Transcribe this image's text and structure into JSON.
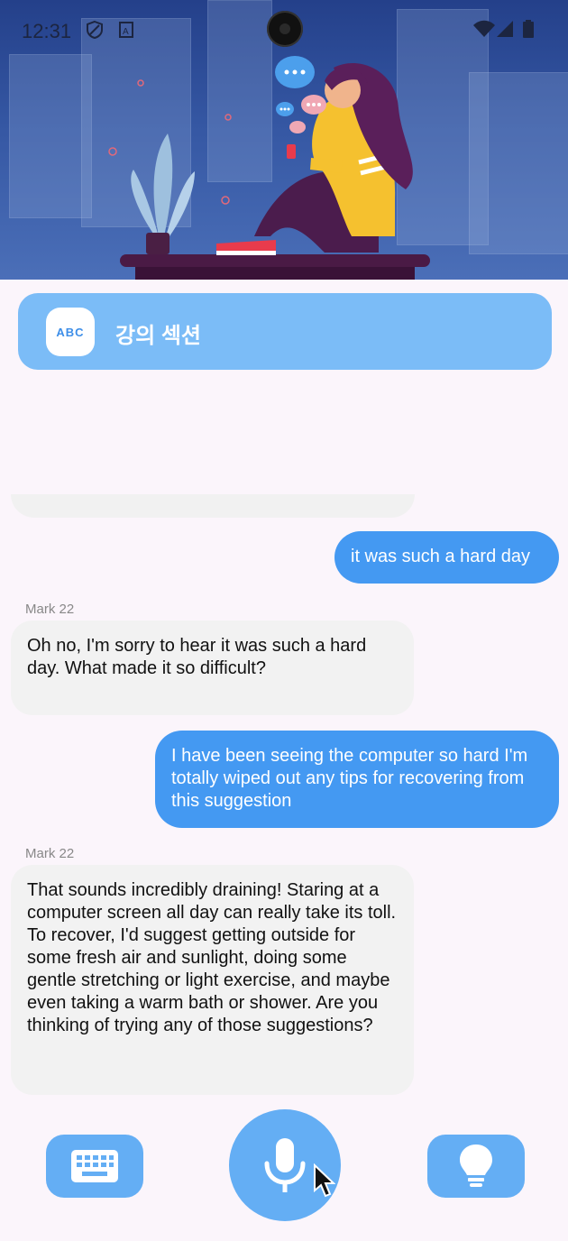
{
  "status_bar": {
    "time": "12:31"
  },
  "lecture": {
    "badge": "ABC",
    "title": "강의 섹션"
  },
  "chat": {
    "messages": [
      {
        "role": "user",
        "text": "it was such a hard day"
      },
      {
        "role": "bot",
        "sender": "Mark 22",
        "text": "Oh no, I'm sorry to hear it was such a hard day.  What made it so difficult?"
      },
      {
        "role": "user",
        "text": "I have been seeing the computer so hard I'm totally wiped out any tips for recovering from this suggestion"
      },
      {
        "role": "bot",
        "sender": "Mark 22",
        "text": "That sounds incredibly draining!  Staring at a computer screen all day can really take its toll.  To recover, I'd suggest getting outside for some fresh air and sunlight, doing some gentle stretching or light exercise, and maybe even taking a warm bath or shower.  Are you thinking of trying any of those suggestions?"
      }
    ]
  },
  "controls": {
    "left_icon": "keyboard-icon",
    "center_icon": "microphone-icon",
    "right_icon": "lightbulb-icon"
  },
  "colors": {
    "accent": "#4499f2",
    "card": "#7bbcf7",
    "button": "#64aef4",
    "background": "#fbf5fb"
  }
}
